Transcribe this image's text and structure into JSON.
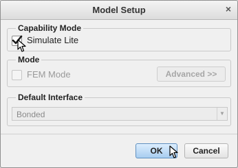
{
  "window": {
    "title": "Model Setup",
    "close_glyph": "×"
  },
  "capability_mode": {
    "legend": "Capability Mode",
    "simulate_lite": {
      "label": "Simulate Lite",
      "checked": true
    }
  },
  "mode": {
    "legend": "Mode",
    "fem_mode": {
      "label": "FEM Mode",
      "checked": false,
      "enabled": false
    },
    "advanced_button": "Advanced >>"
  },
  "default_interface": {
    "legend": "Default Interface",
    "selected": "Bonded",
    "options": [
      "Bonded"
    ]
  },
  "footer": {
    "ok_label": "OK",
    "cancel_label": "Cancel"
  },
  "icons": {
    "close": "close-icon",
    "check": "checkmark-icon",
    "cursor": "mouse-pointer-icon",
    "dropdown": "chevron-down-icon"
  }
}
